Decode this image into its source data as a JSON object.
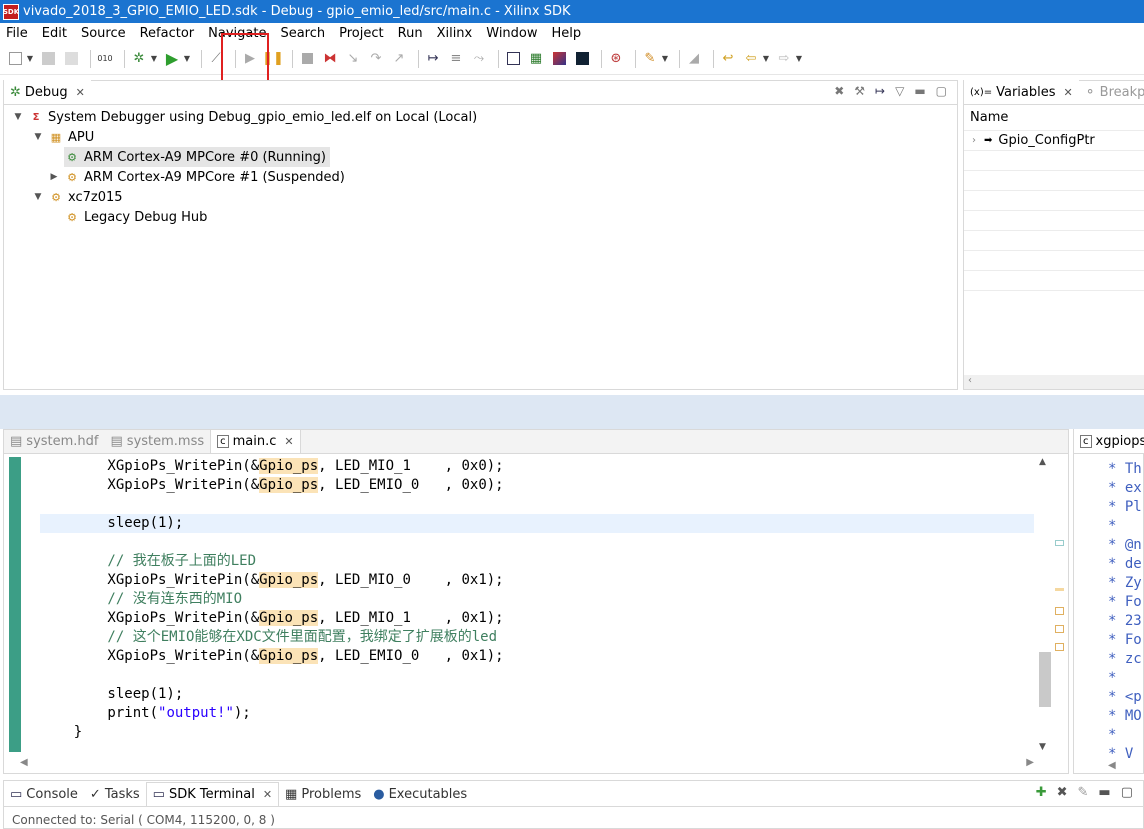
{
  "window": {
    "title": "vivado_2018_3_GPIO_EMIO_LED.sdk - Debug - gpio_emio_led/src/main.c - Xilinx SDK",
    "app_icon_text": "SDK"
  },
  "menu": [
    {
      "label": "File"
    },
    {
      "label": "Edit"
    },
    {
      "label": "Source"
    },
    {
      "label": "Refactor"
    },
    {
      "label": "Navigate"
    },
    {
      "label": "Search"
    },
    {
      "label": "Project"
    },
    {
      "label": "Run"
    },
    {
      "label": "Xilinx"
    },
    {
      "label": "Window"
    },
    {
      "label": "Help"
    }
  ],
  "debug_view": {
    "tab_label": "Debug",
    "tree": {
      "root": "System Debugger using Debug_gpio_emio_led.elf on Local (Local)",
      "apu": "APU",
      "core0": "ARM Cortex-A9 MPCore #0 (Running)",
      "core1": "ARM Cortex-A9 MPCore #1 (Suspended)",
      "target": "xc7z015",
      "hub": "Legacy Debug Hub"
    }
  },
  "variables_view": {
    "tab_label": "Variables",
    "tab2_label": "Breakpoi",
    "column_name": "Name",
    "rows": [
      {
        "name": "Gpio_ConfigPtr"
      }
    ]
  },
  "editor": {
    "tabs": [
      {
        "label": "system.hdf"
      },
      {
        "label": "system.mss"
      },
      {
        "label": "main.c"
      }
    ],
    "second_tab": "xgpiops"
  },
  "console": {
    "tabs": [
      {
        "label": "Console"
      },
      {
        "label": "Tasks"
      },
      {
        "label": "SDK Terminal"
      },
      {
        "label": "Problems"
      },
      {
        "label": "Executables"
      }
    ],
    "status": "Connected to: Serial (  COM4, 115200, 0, 8 )"
  },
  "code_lines": [
    {
      "text": "        XGpioPs_WritePin(&Gpio_ps, LED_MIO_1    , 0x0);"
    },
    {
      "text": "        XGpioPs_WritePin(&Gpio_ps, LED_EMIO_0   , 0x0);"
    },
    {
      "text": ""
    },
    {
      "text": "        sleep(1);"
    },
    {
      "text": ""
    },
    {
      "text": "        // 我在板子上面的LED"
    },
    {
      "text": "        XGpioPs_WritePin(&Gpio_ps, LED_MIO_0    , 0x1);"
    },
    {
      "text": "        // 没有连东西的MIO"
    },
    {
      "text": "        XGpioPs_WritePin(&Gpio_ps, LED_MIO_1    , 0x1);"
    },
    {
      "text": "        // 这个EMIO能够在XDC文件里面配置，我绑定了扩展板的led"
    },
    {
      "text": "        XGpioPs_WritePin(&Gpio_ps, LED_EMIO_0   , 0x1);"
    },
    {
      "text": ""
    },
    {
      "text": "        sleep(1);"
    },
    {
      "text": "        print(\"output!\");"
    },
    {
      "text": "    }"
    }
  ],
  "code_parts": {
    "pin1_pre": "        XGpioPs_WritePin(&",
    "gpio": "Gpio_ps",
    "mio1_0": ", LED_MIO_1    , 0x0);",
    "emio0_0": ", LED_EMIO_0   , 0x0);",
    "sleep": "        sleep(1);",
    "c1": "        // 我在板子上面的LED",
    "mio0_1": ", LED_MIO_0    , 0x1);",
    "c2": "        // 没有连东西的MIO",
    "mio1_1": ", LED_MIO_1    , 0x1);",
    "c3": "        // 这个EMIO能够在XDC文件里面配置，我绑定了扩展板的led",
    "emio0_1": ", LED_EMIO_0   , 0x1);",
    "print_pre": "        print(",
    "print_str": "\"output!\"",
    "print_post": ");",
    "brace": "    }"
  },
  "second_editor_lines": [
    "* Th",
    "* ex",
    "* Pl",
    "*",
    "* @n",
    "* de",
    "* Zy",
    "* Fo",
    "* 23",
    "* Fo",
    "* zc",
    "*",
    "* <p",
    "* MO",
    "*",
    "* V"
  ],
  "colors": {
    "title_bg": "#1b74d0",
    "highlight": "#fbe3b7",
    "comment": "#3f7f5f",
    "string": "#2a00ff",
    "annotation_box": "#e02020"
  }
}
